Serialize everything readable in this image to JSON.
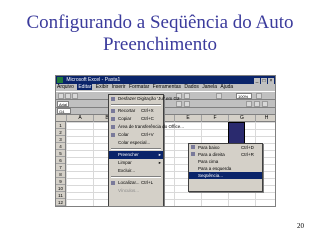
{
  "slide": {
    "title_line1": "Configurando a Seqüência do Auto",
    "title_line2": "Preenchimento",
    "page_number": "20"
  },
  "window": {
    "title": "Microsoft Excel - Pasta1",
    "menus": [
      "Arquivo",
      "Editar",
      "Exibir",
      "Inserir",
      "Formatar",
      "Ferramentas",
      "Dados",
      "Janela",
      "Ajuda"
    ],
    "active_menu_index": 1,
    "undo_label": "Desfazer Digitação 'Jul' em G2",
    "undo_shortcut": "Ctrl+Z",
    "zoom": "100%",
    "font": "Arial",
    "name_box": "G4"
  },
  "columns": [
    "A",
    "B",
    "C",
    "D",
    "E",
    "F",
    "G",
    "H"
  ],
  "rows": [
    "1",
    "2",
    "3",
    "4",
    "5",
    "6",
    "7",
    "8",
    "9",
    "10",
    "11",
    "12"
  ],
  "edit_menu": [
    {
      "label": "Recortar",
      "shortcut": "Ctrl+X"
    },
    {
      "label": "Copiar",
      "shortcut": "Ctrl+C"
    },
    {
      "label": "Área de transferência do Office...",
      "shortcut": ""
    },
    {
      "label": "Colar",
      "shortcut": "Ctrl+V"
    },
    {
      "label": "Colar especial...",
      "shortcut": ""
    },
    {
      "label": "Preencher",
      "shortcut": ""
    },
    {
      "label": "Limpar",
      "shortcut": ""
    },
    {
      "label": "Excluir...",
      "shortcut": ""
    },
    {
      "label": "Localizar...",
      "shortcut": "Ctrl+L"
    },
    {
      "label": "Vínculos...",
      "shortcut": ""
    }
  ],
  "fill_submenu": [
    {
      "label": "Para baixo",
      "shortcut": "Ctrl+D"
    },
    {
      "label": "Para a direita",
      "shortcut": "Ctrl+R"
    },
    {
      "label": "Para cima",
      "shortcut": ""
    },
    {
      "label": "Para a esquerda",
      "shortcut": ""
    },
    {
      "label": "Seqüência...",
      "shortcut": ""
    }
  ],
  "colors": {
    "title": "#3b3b9c",
    "highlight": "#0a246a",
    "selection": "#2a2a6e"
  }
}
